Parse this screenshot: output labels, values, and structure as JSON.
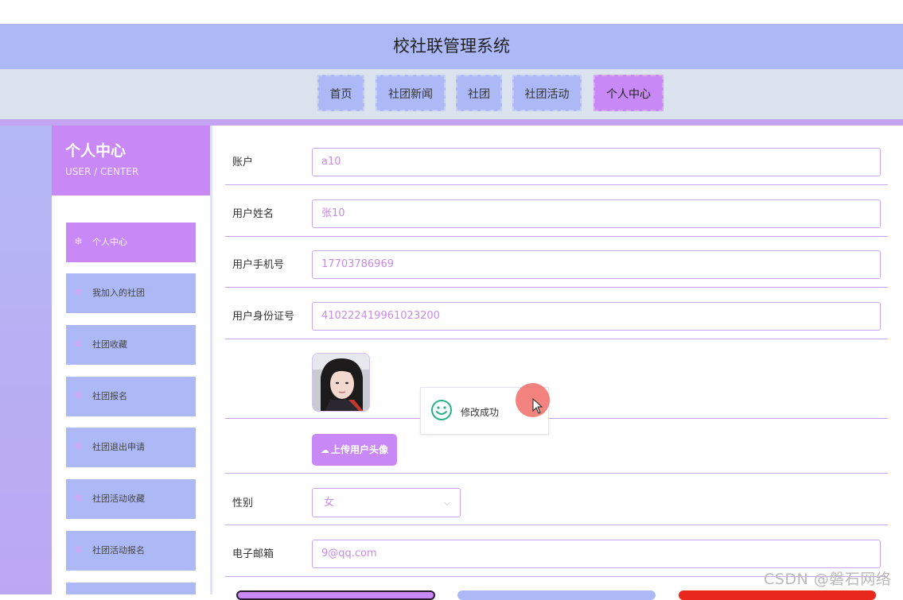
{
  "app": {
    "title": "校社联管理系统"
  },
  "nav": {
    "items": [
      {
        "label": "首页"
      },
      {
        "label": "社团新闻"
      },
      {
        "label": "社团"
      },
      {
        "label": "社团活动"
      },
      {
        "label": "个人中心",
        "active": true
      }
    ]
  },
  "sidebar": {
    "title": "个人中心",
    "subtitle": "USER / CENTER",
    "items": [
      {
        "label": "个人中心",
        "active": true
      },
      {
        "label": "我加入的社团"
      },
      {
        "label": "社团收藏"
      },
      {
        "label": "社团报名"
      },
      {
        "label": "社团退出申请"
      },
      {
        "label": "社团活动收藏"
      },
      {
        "label": "社团活动报名"
      }
    ]
  },
  "form": {
    "account_label": "账户",
    "account_value": "a10",
    "name_label": "用户姓名",
    "name_value": "张10",
    "phone_label": "用户手机号",
    "phone_value": "17703786969",
    "idcard_label": "用户身份证号",
    "idcard_value": "410222419961023200",
    "upload_label": "上传用户头像",
    "gender_label": "性别",
    "gender_value": "女",
    "email_label": "电子邮箱",
    "email_value": "9@qq.com"
  },
  "toast": {
    "message": "修改成功"
  },
  "watermark": "CSDN @磐石网络",
  "colors": {
    "header_bg": "#adb9f6",
    "accent_purple": "#c889f7",
    "nav_bg": "#dbe3ee",
    "input_text": "#c98ae8",
    "bottom_btn_red": "#e8281d"
  },
  "icons": {
    "star": "snowflake-icon",
    "upload": "cloud-upload-icon",
    "success": "smile-icon",
    "select": "chevron-down-icon"
  }
}
